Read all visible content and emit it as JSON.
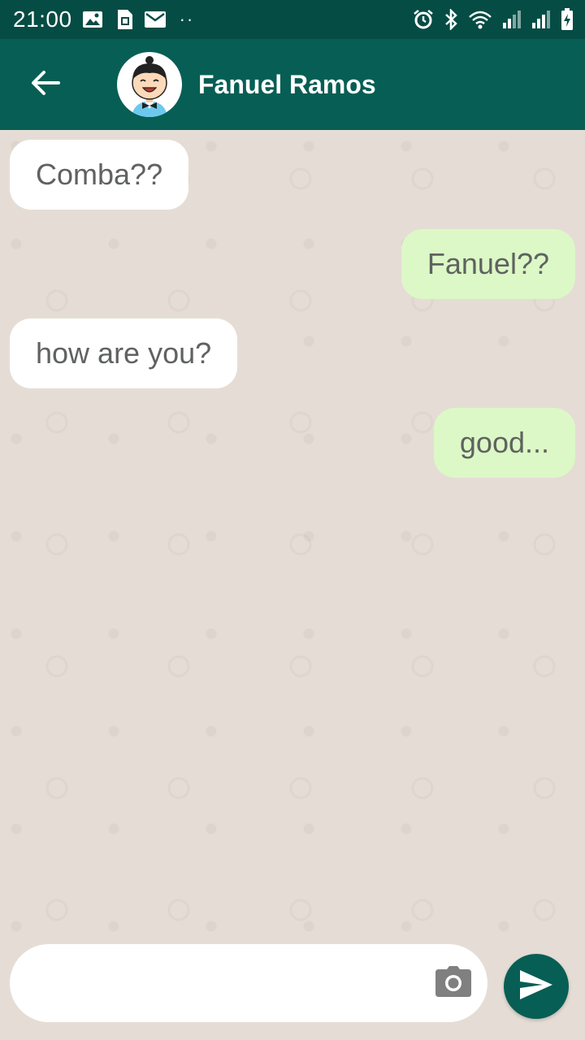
{
  "status_bar": {
    "time": "21:00",
    "left_icons": [
      "image-icon",
      "sim-card-icon",
      "mail-icon"
    ],
    "more_dots": "··",
    "right_icons": [
      "alarm-icon",
      "bluetooth-icon",
      "wifi-icon",
      "signal-icon",
      "signal-icon",
      "battery-charging-icon"
    ]
  },
  "header": {
    "back_icon": "arrow-back-icon",
    "contact_name": "Fanuel Ramos"
  },
  "messages": [
    {
      "direction": "in",
      "text": "Comba??"
    },
    {
      "direction": "out",
      "text": "Fanuel??"
    },
    {
      "direction": "in",
      "text": "how are you?"
    },
    {
      "direction": "out",
      "text": "good..."
    }
  ],
  "composer": {
    "value": "",
    "placeholder": "",
    "camera_icon": "camera-icon",
    "send_icon": "send-icon"
  },
  "colors": {
    "status_bar": "#054c44",
    "app_bar": "#075e54",
    "chat_background": "#e5ddd5",
    "incoming_bubble": "#ffffff",
    "outgoing_bubble": "#dcf8c6",
    "send_button": "#075e54"
  }
}
